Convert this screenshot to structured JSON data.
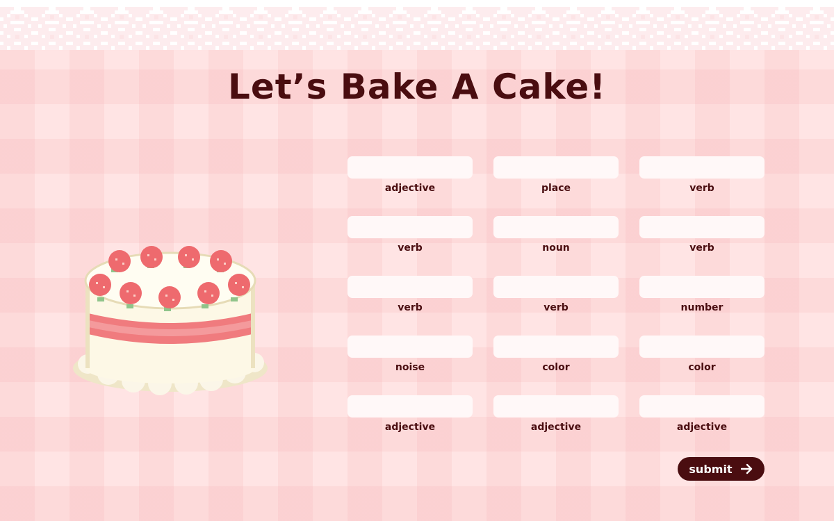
{
  "title": "Let’s Bake A Cake!",
  "cake_image": {
    "icon": "strawberry-cake-icon"
  },
  "fields": [
    {
      "label": "adjective",
      "value": "",
      "placeholder": ""
    },
    {
      "label": "place",
      "value": "",
      "placeholder": ""
    },
    {
      "label": "verb",
      "value": "",
      "placeholder": ""
    },
    {
      "label": "verb",
      "value": "",
      "placeholder": ""
    },
    {
      "label": "noun",
      "value": "",
      "placeholder": ""
    },
    {
      "label": "verb",
      "value": "",
      "placeholder": ""
    },
    {
      "label": "verb",
      "value": "",
      "placeholder": ""
    },
    {
      "label": "verb",
      "value": "",
      "placeholder": ""
    },
    {
      "label": "number",
      "value": "",
      "placeholder": ""
    },
    {
      "label": "noise",
      "value": "",
      "placeholder": ""
    },
    {
      "label": "color",
      "value": "",
      "placeholder": ""
    },
    {
      "label": "color",
      "value": "",
      "placeholder": ""
    },
    {
      "label": "adjective",
      "value": "",
      "placeholder": ""
    },
    {
      "label": "adjective",
      "value": "",
      "placeholder": ""
    },
    {
      "label": "adjective",
      "value": "",
      "placeholder": ""
    }
  ],
  "submit": {
    "label": "submit",
    "icon": "arrow-right-icon"
  },
  "colors": {
    "background": "#ffe4e4",
    "gingham": "#f4aaaf",
    "accent": "#4a0d10",
    "input_fill": "#fff8f8",
    "lace": "#ffffff"
  }
}
